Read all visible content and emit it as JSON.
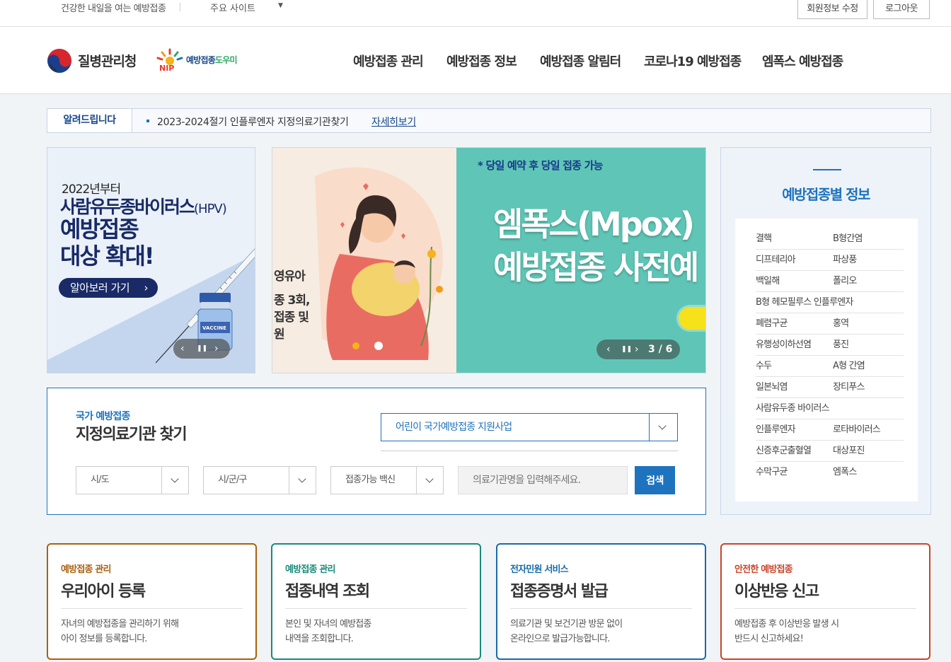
{
  "topbar": {
    "slogan": "건강한 내일을 여는 예방접종",
    "sites": "주요 사이트",
    "sites_arrow": "▼",
    "member_btn": "회원정보 수정",
    "logout_btn": "로그아웃"
  },
  "header": {
    "kdca_name": "질병관리청",
    "nip_name_a": "예방접종",
    "nip_name_b": "도우미",
    "nip_letters": "NIP",
    "nav": [
      "예방접종 관리",
      "예방접종 정보",
      "예방접종 알림터",
      "코로나19 예방접종",
      "엠폭스 예방접종"
    ]
  },
  "notice": {
    "label": "알려드립니다",
    "text": "2023-2024절기 인플루엔자 지정의료기관찾기",
    "more": "자세히보기"
  },
  "hpv_banner": {
    "line1": "2022년부터",
    "line2": "사람유두종바이러스",
    "line2_suffix": "(HPV)",
    "line3": "예방접종",
    "line4": "대상 확대!",
    "more_btn": "알아보러 가기",
    "more_chev": "›",
    "vial_label": "VACCINE",
    "prev": "‹",
    "pause": "❚❚",
    "next": "›"
  },
  "slider": {
    "prev_text_1": "영유아",
    "prev_text_2": "종 3회,",
    "prev_text_3": "접종 및",
    "prev_text_4": "원",
    "note": "* 당일 예약 후 당일 접종 가능",
    "title_1": "엠폭스(Mpox)",
    "title_2": "예방접종 사전예",
    "prev": "‹",
    "pause": "❚❚",
    "next": "›",
    "counter": "3 / 6"
  },
  "find": {
    "kicker": "국가 예방접종",
    "title": "지정의료기관 찾기",
    "program": "어린이 국가예방접종 지원사업",
    "sel_sido": "시/도",
    "sel_sigungu": "시/군/구",
    "sel_vaccine": "접종가능 백신",
    "input_placeholder": "의료기관명을 입력해주세요.",
    "search_btn": "검색"
  },
  "vinfo": {
    "title": "예방접종별 정보",
    "rows": [
      [
        "결핵",
        "B형간염"
      ],
      [
        "디프테리아",
        "파상풍"
      ],
      [
        "백일해",
        "폴리오"
      ],
      [
        "B형 헤모필루스 인플루엔자",
        ""
      ],
      [
        "폐렴구균",
        "홍역"
      ],
      [
        "유행성이하선염",
        "풍진"
      ],
      [
        "수두",
        "A형 간염"
      ],
      [
        "일본뇌염",
        "장티푸스"
      ],
      [
        "사람유두종 바이러스",
        ""
      ],
      [
        "인플루엔자",
        "로타바이러스"
      ],
      [
        "신증후군출혈열",
        "대상포진"
      ],
      [
        "수막구균",
        "엠폭스"
      ]
    ]
  },
  "cards": [
    {
      "cat": "예방접종 관리",
      "title": "우리아이 등록",
      "desc1": "자녀의 예방접종을 관리하기 위해",
      "desc2": "아이 정보를 등록합니다.",
      "color": "#a8610f"
    },
    {
      "cat": "예방접종 관리",
      "title": "접종내역 조회",
      "desc1": "본인 및 자녀의 예방접종",
      "desc2": "내역을 조회합니다.",
      "color": "#1a8a7a"
    },
    {
      "cat": "전자민원 서비스",
      "title": "접종증명서 발급",
      "desc1": "의료기관 및 보건기관 방문 없이",
      "desc2": "온라인으로 발급가능합니다.",
      "color": "#1a6aa8"
    },
    {
      "cat": "안전한 예방접종",
      "title": "이상반응 신고",
      "desc1": "예방접종 후 이상반응 발생 시",
      "desc2": "반드시 신고하세요!",
      "color": "#c8452a"
    }
  ]
}
